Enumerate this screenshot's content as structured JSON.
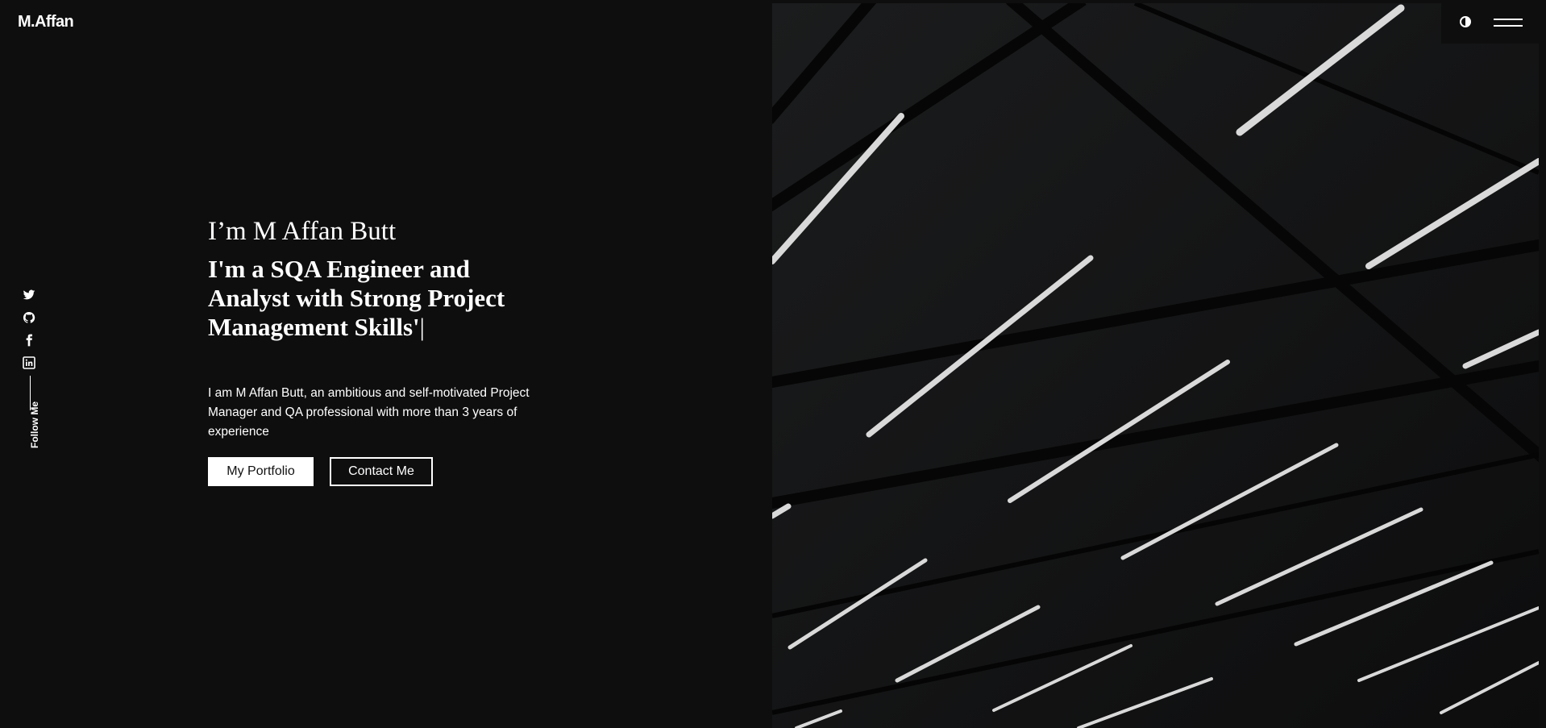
{
  "brand": {
    "logo": "M.Affan"
  },
  "header": {
    "theme_toggle_icon": "contrast-icon",
    "menu_icon": "hamburger-icon"
  },
  "social": {
    "items": [
      {
        "icon": "twitter-icon"
      },
      {
        "icon": "github-icon"
      },
      {
        "icon": "facebook-icon"
      },
      {
        "icon": "linkedin-icon"
      }
    ],
    "label": "Follow Me"
  },
  "hero": {
    "greeting": "I’m M Affan Butt",
    "headline": "I'm a SQA Engineer and Analyst with Strong Project Management Skills'",
    "cursor": "|",
    "bio": "I am M Affan Butt, an ambitious and self-motivated Project Manager and QA professional with more than 3 years of experience",
    "primary_button": "My Portfolio",
    "secondary_button": "Contact Me"
  },
  "colors": {
    "background": "#0e0e0f",
    "text": "#ffffff"
  }
}
